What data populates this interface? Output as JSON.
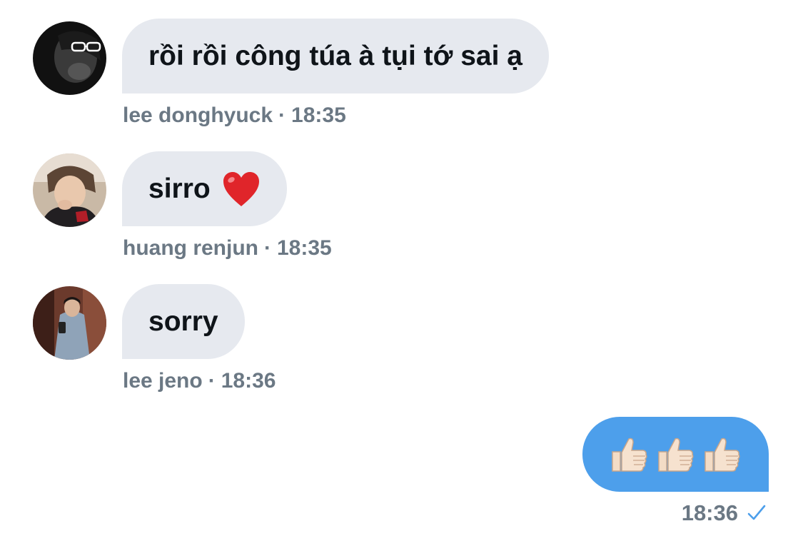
{
  "messages": [
    {
      "sender": "lee donghyuck",
      "text": "rồi rồi công túa à tụi tớ sai ạ",
      "time": "18:35",
      "separator": "·"
    },
    {
      "sender": "huang renjun",
      "text": "sirro",
      "emoji": "heart-icon",
      "time": "18:35",
      "separator": "·"
    },
    {
      "sender": "lee jeno",
      "text": "sorry",
      "time": "18:36",
      "separator": "·"
    }
  ],
  "outgoing": {
    "emojis": [
      "thumbs-up-icon",
      "thumbs-up-icon",
      "thumbs-up-icon"
    ],
    "time": "18:36",
    "status_icon": "checkmark-icon"
  },
  "colors": {
    "incoming_bubble": "#e6e9ef",
    "outgoing_bubble": "#4d9feb",
    "meta_text": "#6b7884",
    "message_text": "#0f1419",
    "check": "#4d9feb"
  }
}
